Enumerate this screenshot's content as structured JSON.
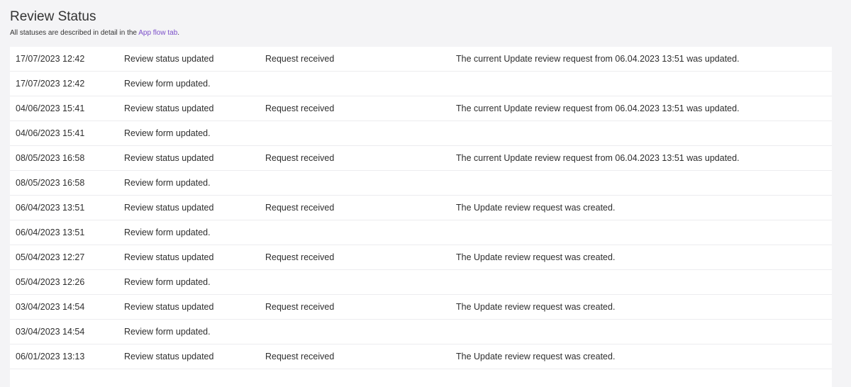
{
  "header": {
    "title": "Review Status",
    "subtitle_prefix": "All statuses are described in detail in the ",
    "subtitle_link": "App flow tab",
    "subtitle_suffix": "."
  },
  "rows": [
    {
      "date": "17/07/2023 12:42",
      "event": "Review status updated",
      "status": "Request received",
      "message": "The current Update review request from 06.04.2023 13:51 was updated."
    },
    {
      "date": "17/07/2023 12:42",
      "event": "Review form updated.",
      "status": "",
      "message": ""
    },
    {
      "date": "04/06/2023 15:41",
      "event": "Review status updated",
      "status": "Request received",
      "message": "The current Update review request from 06.04.2023 13:51 was updated."
    },
    {
      "date": "04/06/2023 15:41",
      "event": "Review form updated.",
      "status": "",
      "message": ""
    },
    {
      "date": "08/05/2023 16:58",
      "event": "Review status updated",
      "status": "Request received",
      "message": "The current Update review request from 06.04.2023 13:51 was updated."
    },
    {
      "date": "08/05/2023 16:58",
      "event": "Review form updated.",
      "status": "",
      "message": ""
    },
    {
      "date": "06/04/2023 13:51",
      "event": "Review status updated",
      "status": "Request received",
      "message": "The Update review request was created."
    },
    {
      "date": "06/04/2023 13:51",
      "event": "Review form updated.",
      "status": "",
      "message": ""
    },
    {
      "date": "05/04/2023 12:27",
      "event": "Review status updated",
      "status": "Request received",
      "message": "The Update review request was created."
    },
    {
      "date": "05/04/2023 12:26",
      "event": "Review form updated.",
      "status": "",
      "message": ""
    },
    {
      "date": "03/04/2023 14:54",
      "event": "Review status updated",
      "status": "Request received",
      "message": "The Update review request was created."
    },
    {
      "date": "03/04/2023 14:54",
      "event": "Review form updated.",
      "status": "",
      "message": ""
    },
    {
      "date": "06/01/2023 13:13",
      "event": "Review status updated",
      "status": "Request received",
      "message": "The Update review request was created."
    }
  ]
}
